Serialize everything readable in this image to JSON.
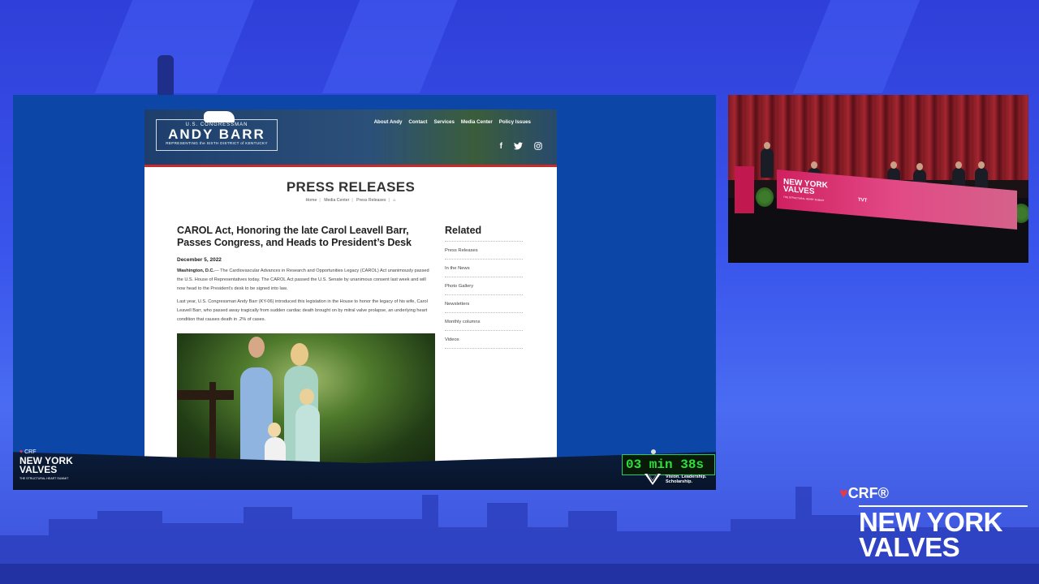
{
  "website": {
    "logo": {
      "line1": "U.S. CONGRESSMAN",
      "line2": "ANDY BARR",
      "line3": "REPRESENTING the SIXTH DISTRICT of KENTUCKY"
    },
    "nav": [
      "About Andy",
      "Contact",
      "Services",
      "Media Center",
      "Policy Issues"
    ],
    "social": [
      "f",
      "t",
      "ig"
    ],
    "page_title": "PRESS RELEASES",
    "breadcrumbs": [
      "Home",
      "Media Center",
      "Press Releases"
    ],
    "article": {
      "headline": "CAROL Act, Honoring the late Carol Leavell Barr, Passes Congress, and Heads to President’s Desk",
      "date": "December 5, 2022",
      "dateline": "Washington, D.C.",
      "paragraph1": "— The Cardiovascular Advances in Research and Opportunities Legacy (CAROL) Act unanimously passed the U.S. House of Representatives today. The CAROL Act passed the U.S. Senate by unanimous consent last week and will now head to the President’s desk to be signed into law.",
      "paragraph2": "Last year, U.S. Congressman Andy Barr (KY-06) introduced this legislation in the House to honor the legacy of his wife, Carol Leavell Barr, who passed away tragically from sudden cardiac death brought on by mitral valve prolapse, an underlying heart condition that causes death in .2% of cases."
    },
    "related": {
      "heading": "Related",
      "items": [
        "Press Releases",
        "In the News",
        "Photo Gallery",
        "Newsletters",
        "Monthly columns",
        "Videos"
      ]
    }
  },
  "overlay": {
    "crf": "CRF",
    "event_name_line1": "NEW YORK",
    "event_name_line2": "VALVES",
    "event_tagline": "THE STRUCTURAL HEART SUMMIT",
    "timer": "03 min 38s",
    "vision_line1": "Vision. Leadership.",
    "vision_line2": "Scholarship."
  },
  "branding": {
    "crf": "CRF®",
    "line1": "NEW YORK",
    "line2": "VALVES"
  },
  "camera": {
    "table_line1": "NEW YORK",
    "table_line2": "VALVES",
    "table_tagline": "THE STRUCTURAL HEART SUMMIT",
    "sponsor": "TVT"
  },
  "colors": {
    "background": "#3a56ec",
    "stage": "#0c46a6",
    "accent_red": "#c92a2a",
    "timer_green": "#2ce03a",
    "table_pink": "#d02060"
  }
}
